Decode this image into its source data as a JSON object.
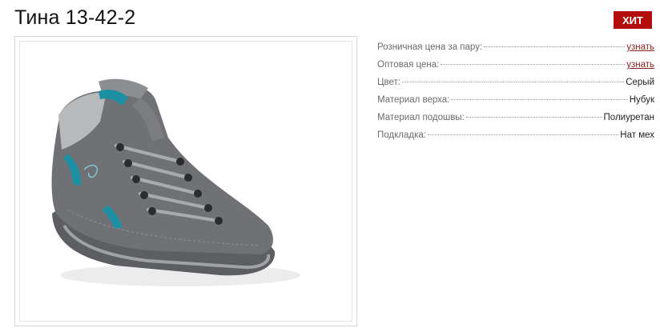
{
  "product": {
    "title": "Тина 13-42-2",
    "badge": "ХИТ"
  },
  "specs": [
    {
      "label": "Розничная цена за пару:",
      "value": "узнать",
      "link": true
    },
    {
      "label": "Оптовая цена:",
      "value": "узнать",
      "link": true
    },
    {
      "label": "Цвет:",
      "value": "Серый",
      "link": false
    },
    {
      "label": "Материал верха:",
      "value": "Нубук",
      "link": false
    },
    {
      "label": "Материал подошвы:",
      "value": "Полиуретан",
      "link": false
    },
    {
      "label": "Подкладка:",
      "value": "Нат мех",
      "link": false
    }
  ],
  "colors": {
    "badge": "#b30d0d",
    "link": "#8a1f1f",
    "shoe": "#6f7174",
    "accent": "#1d8fa3"
  }
}
